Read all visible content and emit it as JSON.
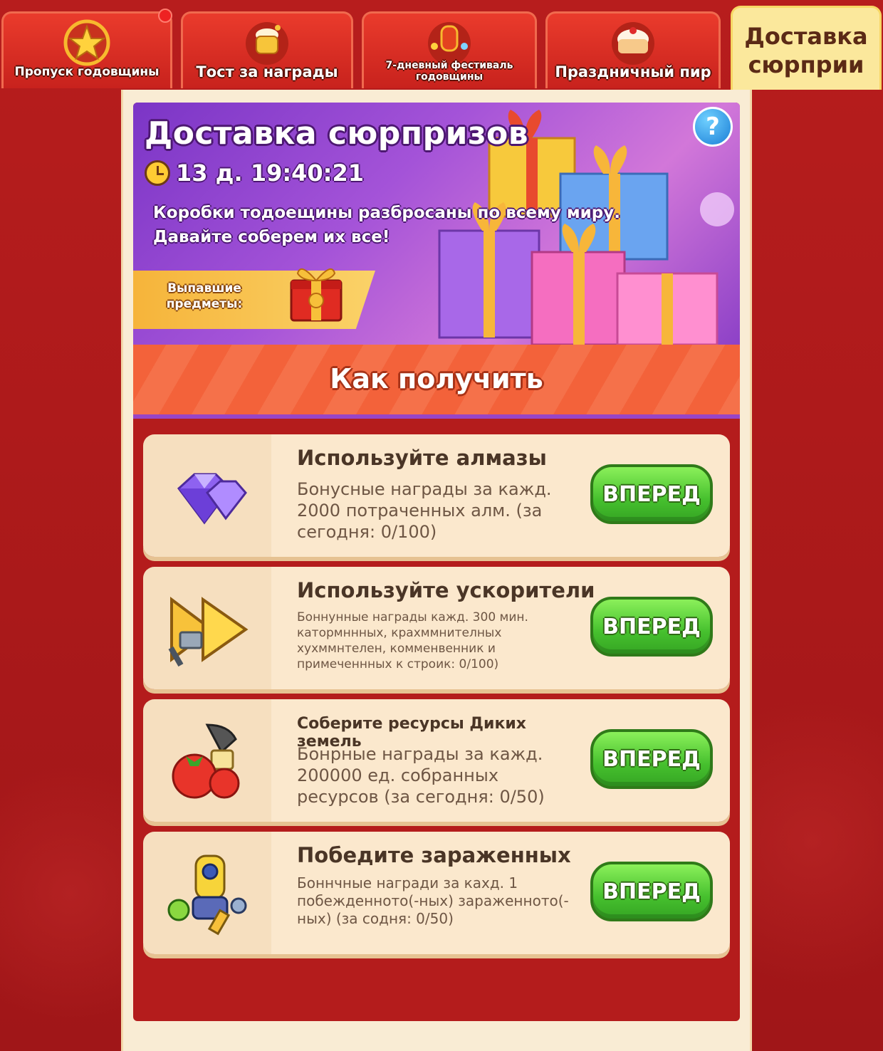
{
  "tabs": [
    {
      "label": "Пропуск годовщины"
    },
    {
      "label": "Тост за награды"
    },
    {
      "label": "7-дневный фестиваль годовщины"
    },
    {
      "label": "Праздничный пир"
    },
    {
      "label": "Доставка сюрприи"
    }
  ],
  "banner": {
    "title": "Доставка сюрпризов",
    "timer": "13 д. 19:40:21",
    "description_line1": "Коробки тодоещины разбросаны по всему миру.",
    "description_line2": "Давайте соберем их все!",
    "drop_label": "Выпавшие предметы:",
    "help": "?"
  },
  "how_to_get": "Как получить",
  "tasks": [
    {
      "title": "Используйте алмазы",
      "description": "Бонусные награды за кажд. 2000 потраченных алм. (за сегодня: 0/100)",
      "button": "ВПЕРЕД",
      "icon": "diamond-icon"
    },
    {
      "title": "Используйте ускорители",
      "description": "Боннунные награды кажд. 300 мин. катормннных, крахммнителных хухммнтелен, комменвенник и примеченнных к строик: 0/100)",
      "button": "ВПЕРЕД",
      "icon": "speedup-icon"
    },
    {
      "title": "Соберите ресурсы Диких земель",
      "description": "Бонрные награды за кажд. 200000 ед. собранных ресурсов (за сегодня: 0/50)",
      "button": "ВПЕРЕД",
      "icon": "resources-icon"
    },
    {
      "title": "Победите зараженных",
      "description": "Боннчные награди за кахд. 1 побежденното(-ных) зараженното(-ных) (за содня: 0/50)",
      "button": "ВПЕРЕД",
      "icon": "infected-icon"
    }
  ]
}
